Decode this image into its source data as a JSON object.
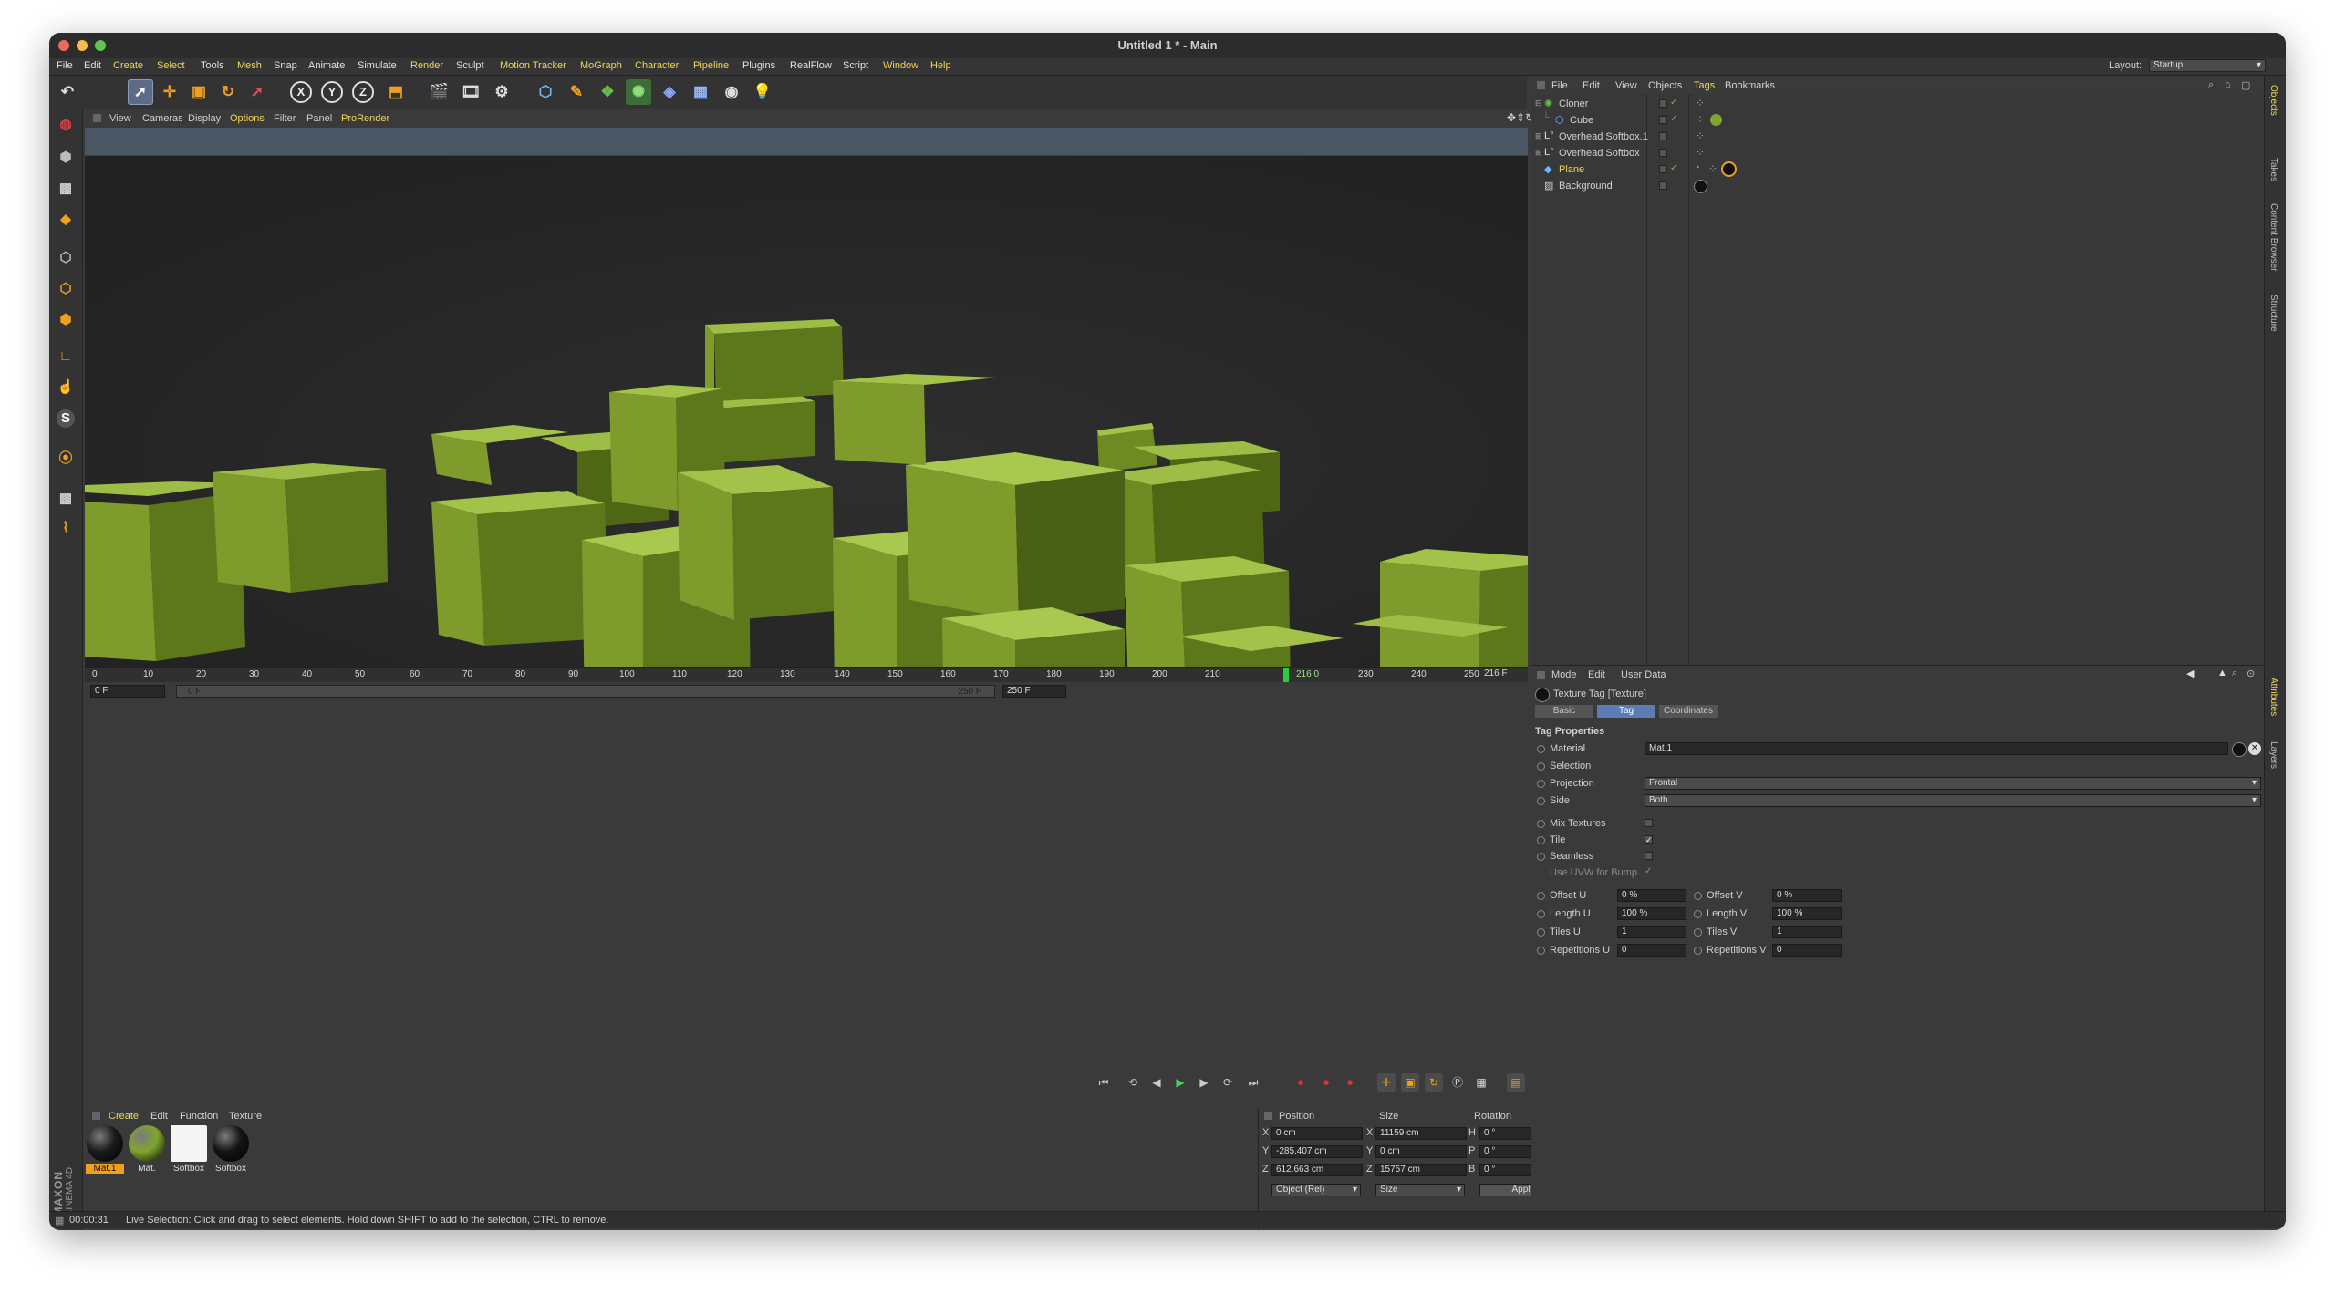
{
  "window": {
    "title": "Untitled 1 * - Main"
  },
  "menubar": {
    "items": [
      "File",
      "Edit",
      "Create",
      "Select",
      "Tools",
      "Mesh",
      "Snap",
      "Animate",
      "Simulate",
      "Render",
      "Sculpt",
      "Motion Tracker",
      "MoGraph",
      "Character",
      "Pipeline",
      "Plugins",
      "RealFlow",
      "Script",
      "Window",
      "Help"
    ],
    "layout_label": "Layout:",
    "layout_value": "Startup"
  },
  "toolbar": {
    "icons": [
      "undo-icon",
      "live-selection-icon",
      "move-icon",
      "scale-icon",
      "rotate-icon",
      "select-icon",
      "x-axis-icon",
      "y-axis-icon",
      "z-axis-icon",
      "coord-system-icon",
      "render-view-icon",
      "render-picture-queue-icon",
      "render-settings-icon",
      "cube-icon",
      "pen-icon",
      "subdivision-icon",
      "cloner-icon",
      "deformer-icon",
      "floor-icon",
      "camera-icon",
      "light-icon"
    ],
    "axis_labels": [
      "X",
      "Y",
      "Z"
    ]
  },
  "left_toolbar": {
    "icons": [
      "make-editable-icon",
      "model-mode-icon",
      "texture-mode-icon",
      "workplane-icon",
      "points-mode-icon",
      "edges-mode-icon",
      "polygons-mode-icon",
      "axis-mode-icon",
      "tweak-icon",
      "snap-icon",
      "magnet-icon",
      "solo-icon",
      "hair-icon"
    ]
  },
  "viewport": {
    "menu": [
      "View",
      "Cameras",
      "Display",
      "Options",
      "Filter",
      "Panel",
      "ProRender"
    ],
    "highlighted": [
      "Options",
      "ProRender"
    ]
  },
  "timeline": {
    "ticks": [
      "0",
      "10",
      "20",
      "30",
      "40",
      "50",
      "60",
      "70",
      "80",
      "90",
      "100",
      "110",
      "120",
      "130",
      "140",
      "150",
      "160",
      "170",
      "180",
      "190",
      "200",
      "210",
      "216 0",
      "230",
      "240",
      "250"
    ],
    "current_frame_label": "216 F",
    "start_field": "0 F",
    "slider_start": "0 F",
    "slider_end": "250 F",
    "end_field": "250 F",
    "current_frame": 216,
    "max_frame": 250
  },
  "materials": {
    "menu": [
      "Create",
      "Edit",
      "Function",
      "Texture"
    ],
    "items": [
      {
        "label": "Mat.1",
        "color": "#1a1a1a",
        "selected": true
      },
      {
        "label": "Mat.",
        "color": "#7fa52e",
        "selected": false
      },
      {
        "label": "Softbox",
        "color": "#f5f5f5",
        "selected": false
      },
      {
        "label": "Softbox",
        "color": "#141414",
        "selected": false
      }
    ]
  },
  "coordinates": {
    "headers": [
      "Position",
      "Size",
      "Rotation"
    ],
    "rows": [
      {
        "axis": "X",
        "pos": "0 cm",
        "size_axis": "X",
        "size": "11159 cm",
        "rot_axis": "H",
        "rot": "0 °"
      },
      {
        "axis": "Y",
        "pos": "-285.407 cm",
        "size_axis": "Y",
        "size": "0 cm",
        "rot_axis": "P",
        "rot": "0 °"
      },
      {
        "axis": "Z",
        "pos": "612.663 cm",
        "size_axis": "Z",
        "size": "15757 cm",
        "rot_axis": "B",
        "rot": "0 °"
      }
    ],
    "mode_select": "Object (Rel)",
    "size_select": "Size",
    "apply": "Apply"
  },
  "branding": {
    "vendor": "MAXON",
    "product": "CINEMA 4D"
  },
  "statusbar": {
    "time": "00:00:31",
    "message": "Live Selection: Click and drag to select elements. Hold down SHIFT to add to the selection, CTRL to remove."
  },
  "object_manager": {
    "menu": [
      "File",
      "Edit",
      "View",
      "Objects",
      "Tags",
      "Bookmarks"
    ],
    "highlighted": "Tags",
    "objects": [
      {
        "name": "Cloner",
        "indent": 0,
        "highlight": false
      },
      {
        "name": "Cube",
        "indent": 1,
        "highlight": false
      },
      {
        "name": "Overhead Softbox.1",
        "indent": 0,
        "highlight": false
      },
      {
        "name": "Overhead Softbox",
        "indent": 0,
        "highlight": false
      },
      {
        "name": "Plane",
        "indent": 0,
        "highlight": true
      },
      {
        "name": "Background",
        "indent": 0,
        "highlight": false
      }
    ]
  },
  "attribute_manager": {
    "menu": [
      "Mode",
      "Edit",
      "User Data"
    ],
    "header": "Texture Tag [Texture]",
    "tabs": [
      "Basic",
      "Tag",
      "Coordinates"
    ],
    "active_tab": "Tag",
    "section": "Tag Properties",
    "material_label": "Material",
    "material_value": "Mat.1",
    "selection_label": "Selection",
    "projection_label": "Projection",
    "projection_value": "Frontal",
    "side_label": "Side",
    "side_value": "Both",
    "mix_textures_label": "Mix Textures",
    "tile_label": "Tile",
    "seamless_label": "Seamless",
    "uvw_bump_label": "Use UVW for Bump",
    "offset_u_label": "Offset U",
    "offset_u": "0 %",
    "offset_v_label": "Offset V",
    "offset_v": "0 %",
    "length_u_label": "Length U",
    "length_u": "100 %",
    "length_v_label": "Length V",
    "length_v": "100 %",
    "tiles_u_label": "Tiles U",
    "tiles_u": "1",
    "tiles_v_label": "Tiles V",
    "tiles_v": "1",
    "rep_u_label": "Repetitions U",
    "rep_u": "0",
    "rep_v_label": "Repetitions V",
    "rep_v": "0"
  },
  "side_tabs": [
    "Objects",
    "Takes",
    "Content Browser",
    "Structure",
    "Attributes",
    "Layers"
  ],
  "colors": {
    "accent": "#f1d75a",
    "active_tab": "#5c7cb5",
    "cube": "#7fa52e",
    "background": "#3a3a3a"
  }
}
